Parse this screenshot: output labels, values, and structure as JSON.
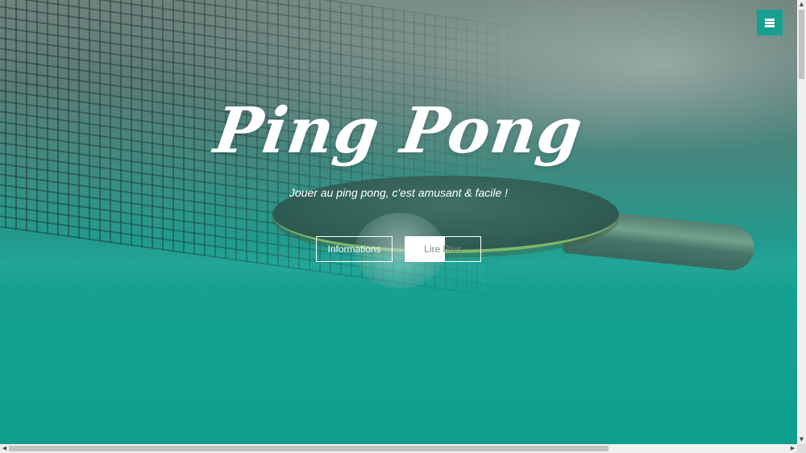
{
  "hero": {
    "title": "Ping Pong",
    "subtitle": "Jouer au ping pong, c'est amusant & facile !",
    "buttons": {
      "informations_label": "Informations",
      "lire_plus_label": "Lire Plus"
    }
  },
  "menu": {
    "icon": "hamburger-menu-icon"
  },
  "scrollbars": {
    "vertical_arrow_up": "▲",
    "vertical_arrow_down": "▼",
    "horizontal_arrow_left": "◀",
    "horizontal_arrow_right": "▶"
  },
  "colors": {
    "accent": "#16a08f",
    "text": "#ffffff"
  }
}
